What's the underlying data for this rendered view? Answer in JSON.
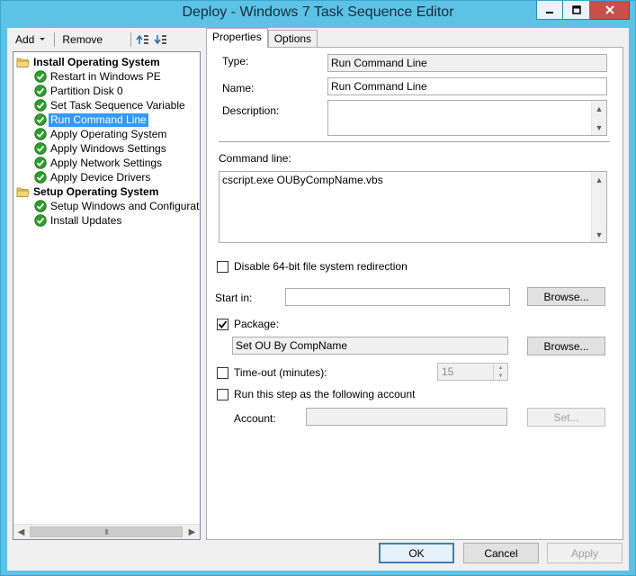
{
  "window": {
    "title": "Deploy - Windows 7 Task Sequence Editor",
    "buttons": [
      "minimize-icon",
      "maximize-icon",
      "close-icon"
    ]
  },
  "toolbar": {
    "add_label": "Add",
    "remove_label": "Remove",
    "icons": [
      "move-up-icon",
      "move-down-icon"
    ]
  },
  "tree": {
    "items": [
      {
        "label": "Install Operating System",
        "type": "group",
        "icon": "folder-icon"
      },
      {
        "label": "Restart in Windows PE",
        "type": "step",
        "icon": "check-icon"
      },
      {
        "label": "Partition Disk 0",
        "type": "step",
        "icon": "check-icon"
      },
      {
        "label": "Set Task Sequence Variable",
        "type": "step",
        "icon": "check-icon"
      },
      {
        "label": "Run Command Line",
        "type": "step",
        "icon": "check-icon",
        "selected": true
      },
      {
        "label": "Apply Operating System",
        "type": "step",
        "icon": "check-icon"
      },
      {
        "label": "Apply Windows Settings",
        "type": "step",
        "icon": "check-icon"
      },
      {
        "label": "Apply Network Settings",
        "type": "step",
        "icon": "check-icon"
      },
      {
        "label": "Apply Device Drivers",
        "type": "step",
        "icon": "check-icon"
      },
      {
        "label": "Setup Operating System",
        "type": "group",
        "icon": "folder-icon"
      },
      {
        "label": "Setup Windows and Configuration",
        "type": "step",
        "icon": "check-icon"
      },
      {
        "label": "Install Updates",
        "type": "step",
        "icon": "check-icon"
      }
    ],
    "scroll_thumb_glyph": "III"
  },
  "tabs": [
    {
      "label": "Properties",
      "active": true
    },
    {
      "label": "Options",
      "active": false
    }
  ],
  "properties": {
    "type_label": "Type:",
    "type_value": "Run Command Line",
    "name_label": "Name:",
    "name_value": "Run Command Line",
    "description_label": "Description:",
    "description_value": "",
    "command_line_label": "Command line:",
    "command_line_value": "cscript.exe OUByCompName.vbs",
    "disable_redirection_label": "Disable 64-bit file system redirection",
    "disable_redirection_checked": false,
    "start_in_label": "Start in:",
    "start_in_value": "",
    "browse_label": "Browse...",
    "package_label": "Package:",
    "package_checked": true,
    "package_value": "Set OU By CompName",
    "timeout_label": "Time-out (minutes):",
    "timeout_checked": false,
    "timeout_value": "15",
    "run_as_label": "Run this step as the following account",
    "run_as_checked": false,
    "account_label": "Account:",
    "account_value": "",
    "set_label": "Set..."
  },
  "footer": {
    "ok_label": "OK",
    "cancel_label": "Cancel",
    "apply_label": "Apply"
  },
  "colors": {
    "titlebar": "#5cc2e6",
    "selection": "#3399ff",
    "check_green": "#2e9e2e",
    "folder_yellow": "#e8c25a"
  }
}
